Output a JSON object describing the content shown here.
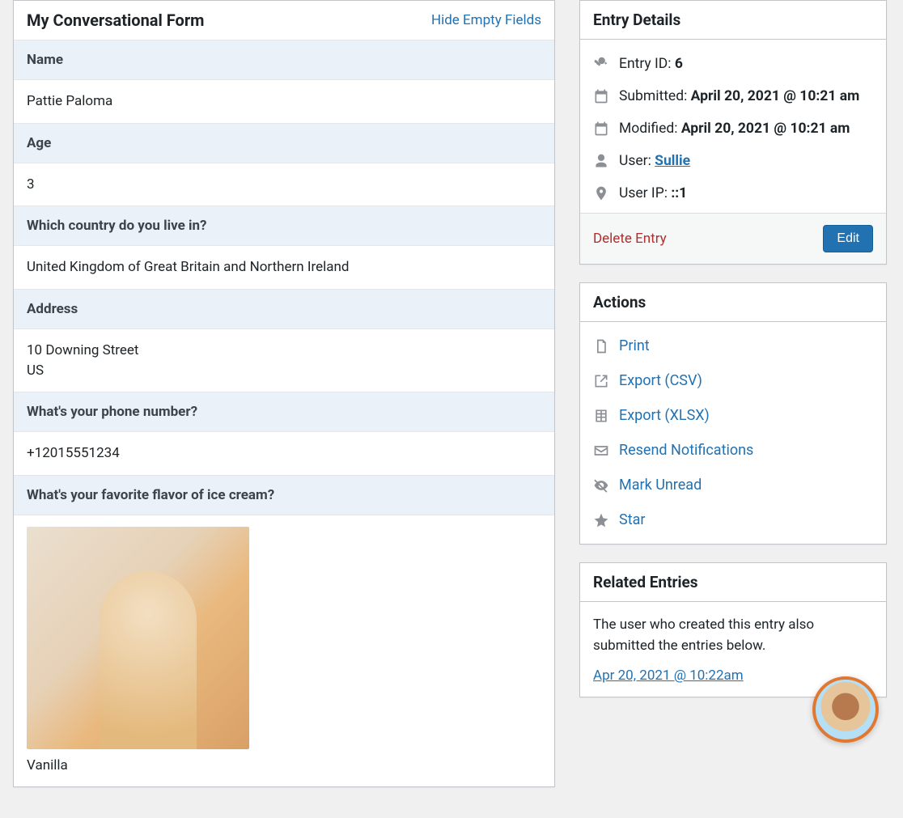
{
  "form": {
    "title": "My Conversational Form",
    "toggle_label": "Hide Empty Fields",
    "fields": {
      "name_label": "Name",
      "name_value": "Pattie Paloma",
      "age_label": "Age",
      "age_value": "3",
      "country_label": "Which country do you live in?",
      "country_value": "United Kingdom of Great Britain and Northern Ireland",
      "address_label": "Address",
      "address_line1": "10 Downing Street",
      "address_line2": "US",
      "phone_label": "What's your phone number?",
      "phone_value": "+12015551234",
      "flavor_label": "What's your favorite flavor of ice cream?",
      "flavor_value": "Vanilla"
    }
  },
  "details": {
    "title": "Entry Details",
    "entry_id_label": "Entry ID: ",
    "entry_id_value": "6",
    "submitted_label": "Submitted: ",
    "submitted_value": "April 20, 2021 @ 10:21 am",
    "modified_label": "Modified: ",
    "modified_value": "April 20, 2021 @ 10:21 am",
    "user_label": "User: ",
    "user_value": "Sullie",
    "ip_label": "User IP: ",
    "ip_value": "::1",
    "delete_label": "Delete Entry",
    "edit_label": "Edit"
  },
  "actions": {
    "title": "Actions",
    "print": "Print",
    "export_csv": "Export (CSV)",
    "export_xlsx": "Export (XLSX)",
    "resend": "Resend Notifications",
    "mark_unread": "Mark Unread",
    "star": "Star"
  },
  "related": {
    "title": "Related Entries",
    "description": "The user who created this entry also submitted the entries below.",
    "link_text": "Apr 20, 2021 @ 10:22am"
  }
}
